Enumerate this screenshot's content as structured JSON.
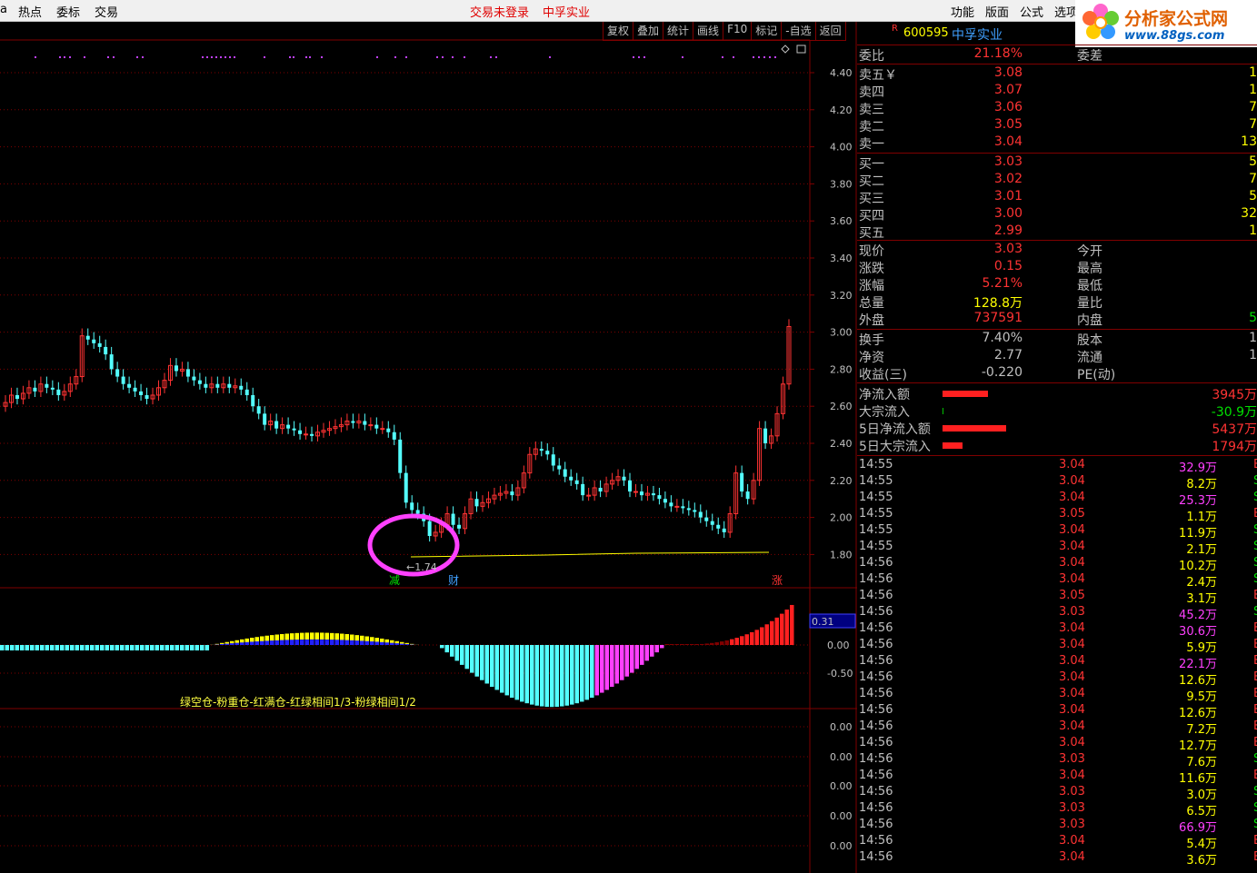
{
  "menubar": {
    "left": [
      "热点",
      "委标",
      "交易"
    ],
    "center_status": "交易未登录",
    "center_name": "中孚实业",
    "right": [
      "功能",
      "版面",
      "公式",
      "选项"
    ]
  },
  "logo": {
    "title": "分析家公式网",
    "url": "www.88gs.com"
  },
  "toolbar": [
    "复权",
    "叠加",
    "统计",
    "画线",
    "F10",
    "标记",
    "-自选",
    "返回"
  ],
  "stock": {
    "flag": "R",
    "code": "600595",
    "name": "中孚实业"
  },
  "price_axis": [
    "4.40",
    "4.20",
    "4.00",
    "3.80",
    "3.60",
    "3.40",
    "3.20",
    "3.00",
    "2.80",
    "2.60",
    "2.40",
    "2.20",
    "2.00",
    "1.80"
  ],
  "chart_labels": {
    "low_marker": "←1.74",
    "tag_left": "减",
    "tag_mid": "财",
    "tag_right": "涨"
  },
  "indicator": {
    "value_box": "0.31",
    "axis": [
      "0.00",
      "-0.50"
    ],
    "legend": "绿空仓-粉重仓-红满仓-红绿相间1/3-粉绿相间1/2"
  },
  "lower_axis": [
    "0.00",
    "0.00",
    "0.00",
    "0.00",
    "0.00"
  ],
  "quote": {
    "weibi": {
      "label": "委比",
      "value": "21.18%",
      "label2": "委差"
    },
    "sell": [
      {
        "label": "卖五￥",
        "price": "3.08",
        "vol": "1"
      },
      {
        "label": "卖四",
        "price": "3.07",
        "vol": "1"
      },
      {
        "label": "卖三",
        "price": "3.06",
        "vol": "7"
      },
      {
        "label": "卖二",
        "price": "3.05",
        "vol": "7"
      },
      {
        "label": "卖一",
        "price": "3.04",
        "vol": "13"
      }
    ],
    "buy": [
      {
        "label": "买一",
        "price": "3.03",
        "vol": "5"
      },
      {
        "label": "买二",
        "price": "3.02",
        "vol": "7"
      },
      {
        "label": "买三",
        "price": "3.01",
        "vol": "5"
      },
      {
        "label": "买四",
        "price": "3.00",
        "vol": "32"
      },
      {
        "label": "买五",
        "price": "2.99",
        "vol": "1"
      }
    ],
    "stats": [
      {
        "label": "现价",
        "value": "3.03",
        "label2": "今开",
        "value2": ""
      },
      {
        "label": "涨跌",
        "value": "0.15",
        "label2": "最高",
        "value2": ""
      },
      {
        "label": "涨幅",
        "value": "5.21%",
        "label2": "最低",
        "value2": ""
      },
      {
        "label": "总量",
        "value": "128.8万",
        "label2": "量比",
        "value2": ""
      },
      {
        "label": "外盘",
        "value": "737591",
        "label2": "内盘",
        "value2": "5"
      }
    ],
    "fund": [
      {
        "label": "换手",
        "value": "7.40%",
        "label2": "股本",
        "value2": "1"
      },
      {
        "label": "净资",
        "value": "2.77",
        "label2": "流通",
        "value2": "1"
      },
      {
        "label": "收益(三)",
        "value": "-0.220",
        "label2": "PE(动)",
        "value2": ""
      }
    ],
    "flows": [
      {
        "label": "净流入额",
        "value": "3945万",
        "bar": 0.45,
        "color": "red"
      },
      {
        "label": "大宗流入",
        "value": "-30.9万",
        "bar": 0.01,
        "color": "green"
      },
      {
        "label": "5日净流入额",
        "value": "5437万",
        "bar": 0.64,
        "color": "red"
      },
      {
        "label": "5日大宗流入",
        "value": "1794万",
        "bar": 0.2,
        "color": "red"
      }
    ]
  },
  "ticks": [
    {
      "time": "14:55",
      "price": "3.04",
      "vol": "32.9万",
      "c": "magenta",
      "bs": "E"
    },
    {
      "time": "14:55",
      "price": "3.04",
      "vol": "8.2万",
      "c": "yellow",
      "bs": "S"
    },
    {
      "time": "14:55",
      "price": "3.04",
      "vol": "25.3万",
      "c": "magenta",
      "bs": "S"
    },
    {
      "time": "14:55",
      "price": "3.05",
      "vol": "1.1万",
      "c": "yellow",
      "bs": "E"
    },
    {
      "time": "14:55",
      "price": "3.04",
      "vol": "11.9万",
      "c": "yellow",
      "bs": "S"
    },
    {
      "time": "14:55",
      "price": "3.04",
      "vol": "2.1万",
      "c": "yellow",
      "bs": "S"
    },
    {
      "time": "14:56",
      "price": "3.04",
      "vol": "10.2万",
      "c": "yellow",
      "bs": "S"
    },
    {
      "time": "14:56",
      "price": "3.04",
      "vol": "2.4万",
      "c": "yellow",
      "bs": "S"
    },
    {
      "time": "14:56",
      "price": "3.05",
      "vol": "3.1万",
      "c": "yellow",
      "bs": "E"
    },
    {
      "time": "14:56",
      "price": "3.03",
      "vol": "45.2万",
      "c": "magenta",
      "bs": "S"
    },
    {
      "time": "14:56",
      "price": "3.04",
      "vol": "30.6万",
      "c": "magenta",
      "bs": "E"
    },
    {
      "time": "14:56",
      "price": "3.04",
      "vol": "5.9万",
      "c": "yellow",
      "bs": "E"
    },
    {
      "time": "14:56",
      "price": "3.04",
      "vol": "22.1万",
      "c": "magenta",
      "bs": "E"
    },
    {
      "time": "14:56",
      "price": "3.04",
      "vol": "12.6万",
      "c": "yellow",
      "bs": "E"
    },
    {
      "time": "14:56",
      "price": "3.04",
      "vol": "9.5万",
      "c": "yellow",
      "bs": "E"
    },
    {
      "time": "14:56",
      "price": "3.04",
      "vol": "12.6万",
      "c": "yellow",
      "bs": "E"
    },
    {
      "time": "14:56",
      "price": "3.04",
      "vol": "7.2万",
      "c": "yellow",
      "bs": "E"
    },
    {
      "time": "14:56",
      "price": "3.04",
      "vol": "12.7万",
      "c": "yellow",
      "bs": "E"
    },
    {
      "time": "14:56",
      "price": "3.03",
      "vol": "7.6万",
      "c": "yellow",
      "bs": "S"
    },
    {
      "time": "14:56",
      "price": "3.04",
      "vol": "11.6万",
      "c": "yellow",
      "bs": "E"
    },
    {
      "time": "14:56",
      "price": "3.03",
      "vol": "3.0万",
      "c": "yellow",
      "bs": "S"
    },
    {
      "time": "14:56",
      "price": "3.03",
      "vol": "6.5万",
      "c": "yellow",
      "bs": "S"
    },
    {
      "time": "14:56",
      "price": "3.03",
      "vol": "66.9万",
      "c": "magenta",
      "bs": "S"
    },
    {
      "time": "14:56",
      "price": "3.04",
      "vol": "5.4万",
      "c": "yellow",
      "bs": "E"
    },
    {
      "time": "14:56",
      "price": "3.04",
      "vol": "3.6万",
      "c": "yellow",
      "bs": "E"
    }
  ],
  "colors": {
    "up": "#ff3333",
    "down": "#54ffff",
    "grid": "#800000",
    "ma": "#ffff00",
    "pink": "#ff40ff"
  }
}
